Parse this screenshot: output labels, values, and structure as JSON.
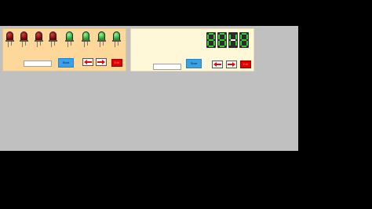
{
  "led_panel": {
    "leds": [
      {
        "color": "red",
        "name": "led-red-1"
      },
      {
        "color": "red",
        "name": "led-red-2"
      },
      {
        "color": "red",
        "name": "led-red-3"
      },
      {
        "color": "red",
        "name": "led-red-4"
      },
      {
        "color": "green",
        "name": "led-green-1"
      },
      {
        "color": "green",
        "name": "led-green-2"
      },
      {
        "color": "green",
        "name": "led-green-3"
      },
      {
        "color": "green",
        "name": "led-green-4"
      }
    ],
    "input_value": "",
    "blue_button_label": "Start",
    "left_arrow_icon": "left-arrow-icon",
    "right_arrow_icon": "right-arrow-icon",
    "red_button_label": "Exit"
  },
  "segment_panel": {
    "digits": [
      "8",
      "8",
      "-",
      "8"
    ],
    "input_value": "",
    "blue_button_label": "Start",
    "left_arrow_icon": "left-arrow-icon",
    "right_arrow_icon": "right-arrow-icon",
    "red_button_label": "Exit"
  },
  "colors": {
    "led_red": "#7a0000",
    "led_green": "#1ea01e",
    "segment_on": "#3ec83e",
    "accent_blue": "#3aa0e8",
    "accent_red": "#e40000"
  }
}
